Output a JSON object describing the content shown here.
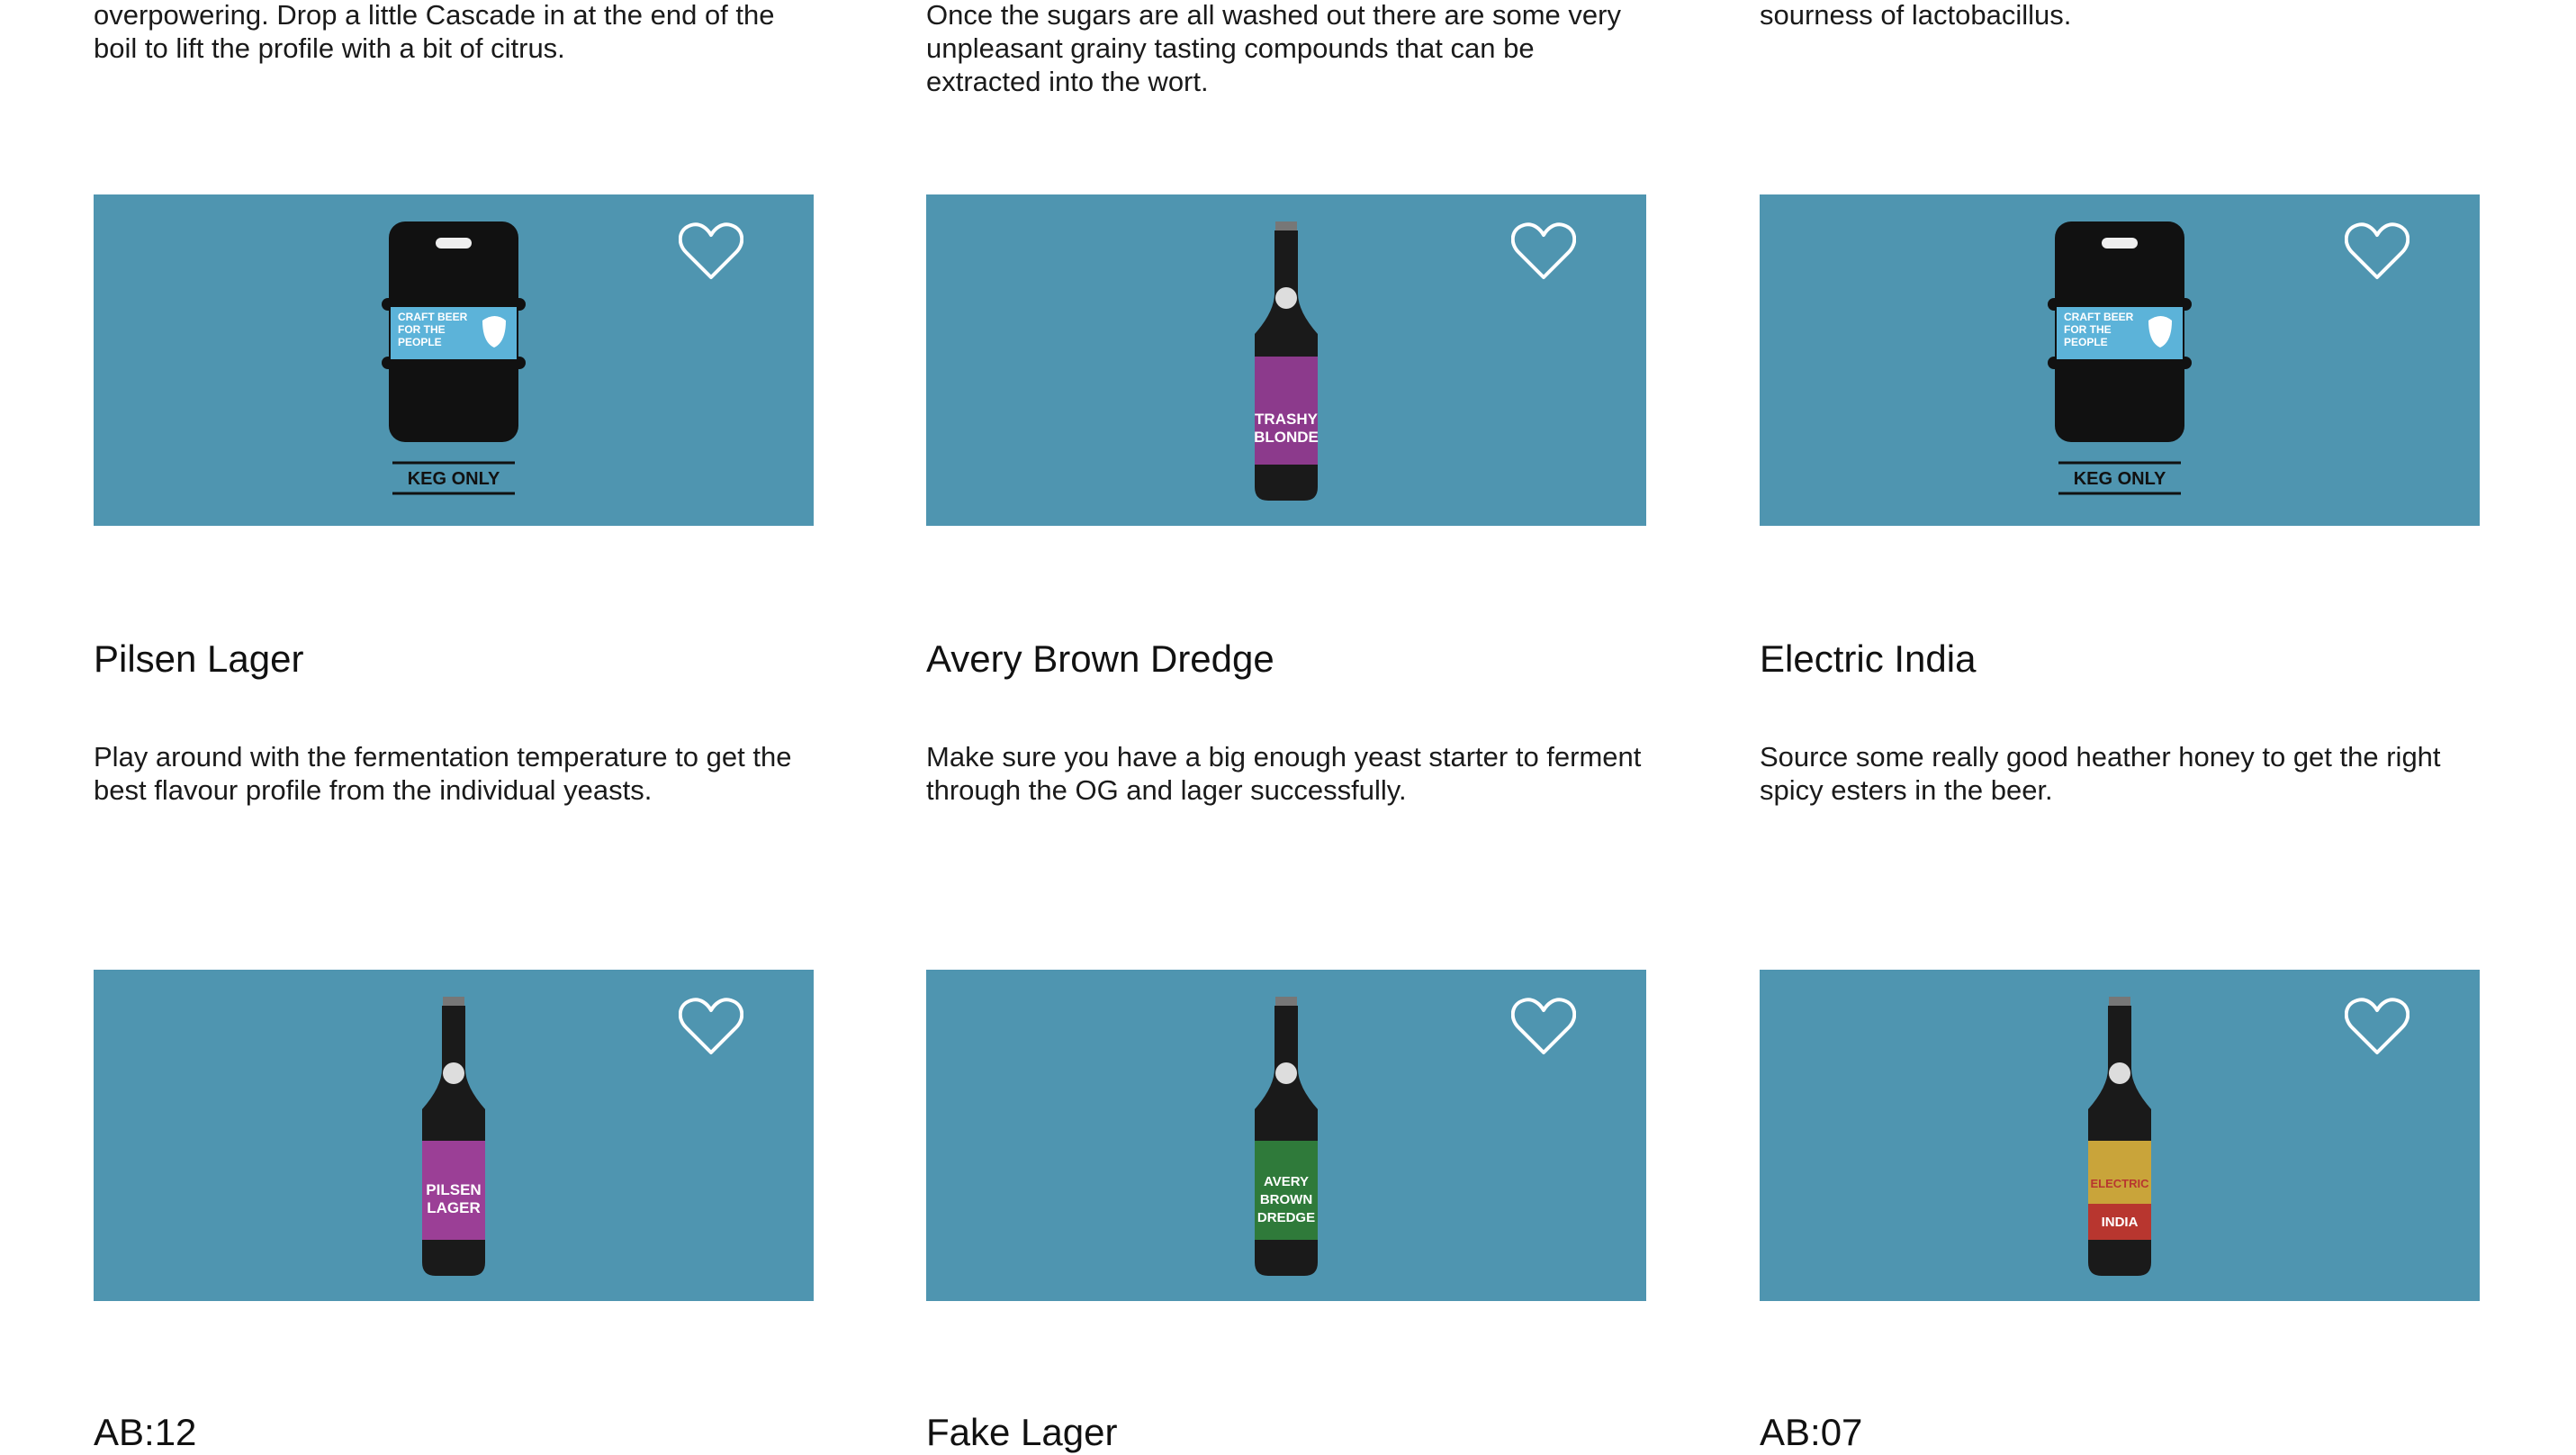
{
  "top_descriptions": [
    "overpowering. Drop a little Cascade in at the end of the boil to lift the profile with a bit of citrus.",
    "Once the sugars are all washed out there are some very unpleasant grainy tasting compounds that can be extracted into the wort.",
    "sourness of lactobacillus."
  ],
  "row1": [
    {
      "title": "Pilsen Lager",
      "description": "Play around with the fermentation temperature to get the best flavour profile from the individual yeasts.",
      "image": {
        "kind": "keg",
        "label_lines": [
          "CRAFT BEER",
          "FOR THE",
          "PEOPLE"
        ],
        "footer": "KEG ONLY",
        "label_color": "#5cb3d9"
      }
    },
    {
      "title": "Avery Brown Dredge",
      "description": "Make sure you have a big enough yeast starter to ferment through the OG and lager successfully.",
      "image": {
        "kind": "bottle",
        "label_lines": [
          "TRASHY",
          "BLONDE"
        ],
        "label_color": "#8c3a8c"
      }
    },
    {
      "title": "Electric India",
      "description": "Source some really good heather honey to get the right spicy esters in the beer.",
      "image": {
        "kind": "keg",
        "label_lines": [
          "CRAFT BEER",
          "FOR THE",
          "PEOPLE"
        ],
        "footer": "KEG ONLY",
        "label_color": "#5cb3d9"
      }
    }
  ],
  "row2": [
    {
      "title": "AB:12",
      "image": {
        "kind": "bottle",
        "label_lines": [
          "PILSEN",
          "LAGER"
        ],
        "label_color": "#9b3f96"
      }
    },
    {
      "title": "Fake Lager",
      "image": {
        "kind": "bottle",
        "label_lines": [
          "AVERY",
          "BROWN",
          "DREDGE"
        ],
        "label_color": "#2f7a3a"
      }
    },
    {
      "title": "AB:07",
      "image": {
        "kind": "bottle",
        "label_lines": [
          "ELECTRIC",
          "INDIA"
        ],
        "label_color": "#c9a43a"
      }
    }
  ],
  "icons": {
    "favorite": "heart-outline-icon"
  },
  "colors": {
    "card_background": "#4f95b0",
    "text": "#111111"
  }
}
